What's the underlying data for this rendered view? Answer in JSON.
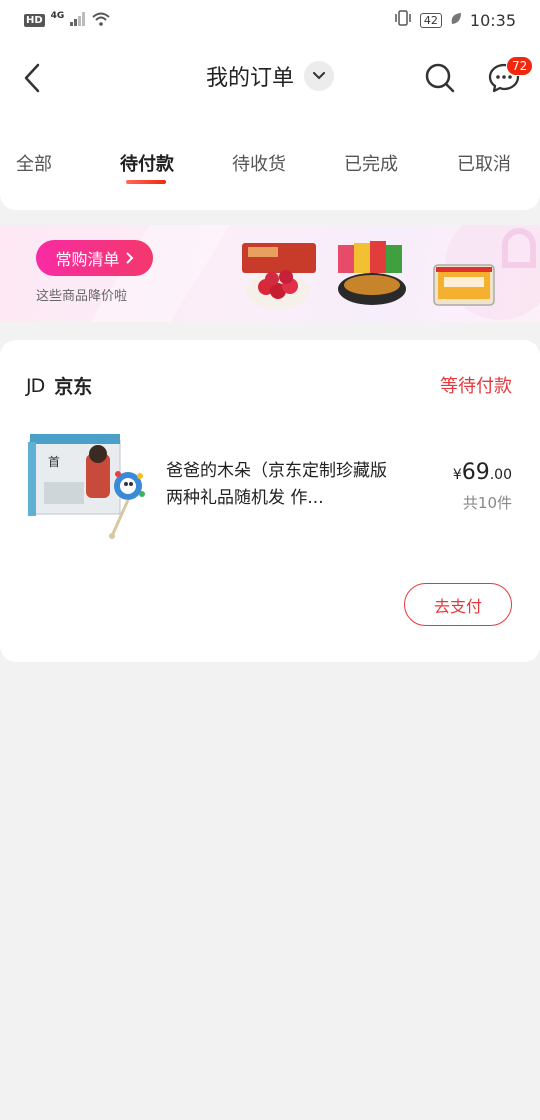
{
  "status_bar": {
    "hd": "HD",
    "network": "4G",
    "battery": "42",
    "time": "10:35"
  },
  "header": {
    "title": "我的订单",
    "badge_count": "72"
  },
  "tabs": [
    {
      "label": "全部",
      "active": false
    },
    {
      "label": "待付款",
      "active": true
    },
    {
      "label": "待收货",
      "active": false
    },
    {
      "label": "已完成",
      "active": false
    },
    {
      "label": "已取消",
      "active": false
    }
  ],
  "banner": {
    "button_label": "常购清单",
    "subtitle": "这些商品降价啦"
  },
  "order": {
    "shop_logo": "JD",
    "shop_name": "京东",
    "status": "等待付款",
    "item_name": "爸爸的木朵（京东定制珍藏版 两种礼品随机发 作...",
    "price_symbol": "¥",
    "price_int": "69",
    "price_dec": ".00",
    "quantity": "共10件",
    "pay_button": "去支付"
  },
  "colors": {
    "accent": "#e4393c",
    "badge": "#f2270c",
    "banner_pink": "#f92ba3"
  }
}
